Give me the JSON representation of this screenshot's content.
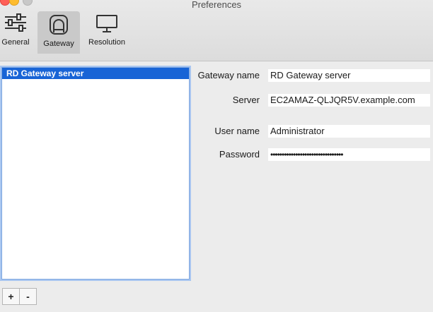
{
  "window": {
    "title": "Preferences"
  },
  "toolbar": {
    "items": [
      {
        "label": "General",
        "icon": "sliders-icon",
        "selected": false
      },
      {
        "label": "Gateway",
        "icon": "gateway-icon",
        "selected": true
      },
      {
        "label": "Resolution",
        "icon": "monitor-icon",
        "selected": false
      }
    ]
  },
  "gateway_list": {
    "items": [
      {
        "label": "RD Gateway server",
        "selected": true
      }
    ],
    "add_label": "+",
    "remove_label": "-"
  },
  "form": {
    "gateway_name_label": "Gateway name",
    "gateway_name_value": "RD Gateway server",
    "server_label": "Server",
    "server_value": "EC2AMAZ-QLJQR5V.example.com",
    "username_label": "User name",
    "username_value": "Administrator",
    "password_label": "Password",
    "password_value": "••••••••••••••••••••••••••••••••"
  },
  "colors": {
    "selection": "#1864d6",
    "window_bg": "#ececec",
    "close": "#fe5f57",
    "minimize": "#febc2e"
  }
}
